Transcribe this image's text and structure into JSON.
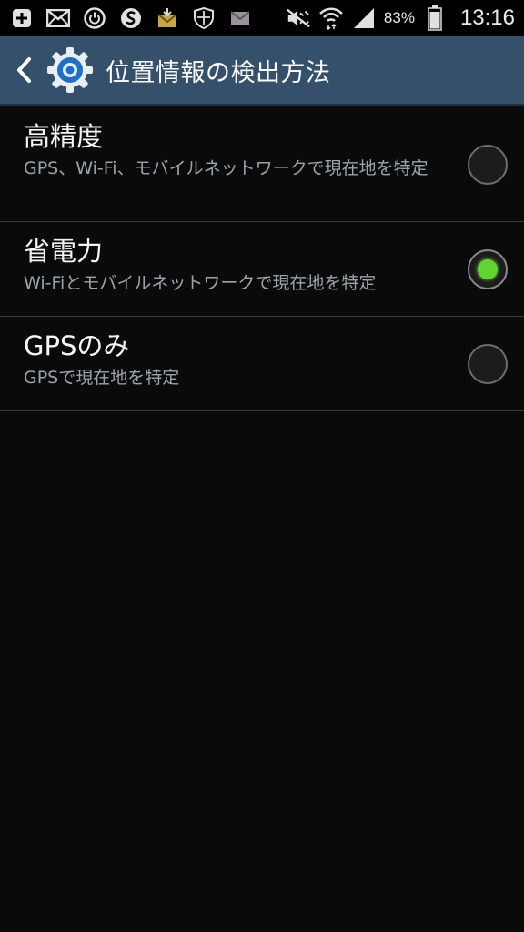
{
  "status_bar": {
    "icons_left": [
      "plus-icon",
      "mail-icon",
      "power-icon",
      "s-app-icon",
      "download-mail-icon",
      "shield-icon",
      "mail-small-icon"
    ],
    "icons_right": [
      "mute-icon",
      "wifi-icon",
      "signal-icon",
      "battery-icon"
    ],
    "battery": "83%",
    "time": "13:16"
  },
  "action_bar": {
    "title": "位置情報の検出方法",
    "accent": "#35506b"
  },
  "options": [
    {
      "title": "高精度",
      "desc": "GPS、Wi-Fi、モバイルネットワークで現在地を特定",
      "selected": false
    },
    {
      "title": "省電力",
      "desc": "Wi-Fiとモバイルネットワークで現在地を特定",
      "selected": true
    },
    {
      "title": "GPSのみ",
      "desc": "GPSで現在地を特定",
      "selected": false
    }
  ],
  "colors": {
    "radio_selected": "#5fd52d",
    "background": "#0a0a0a"
  }
}
